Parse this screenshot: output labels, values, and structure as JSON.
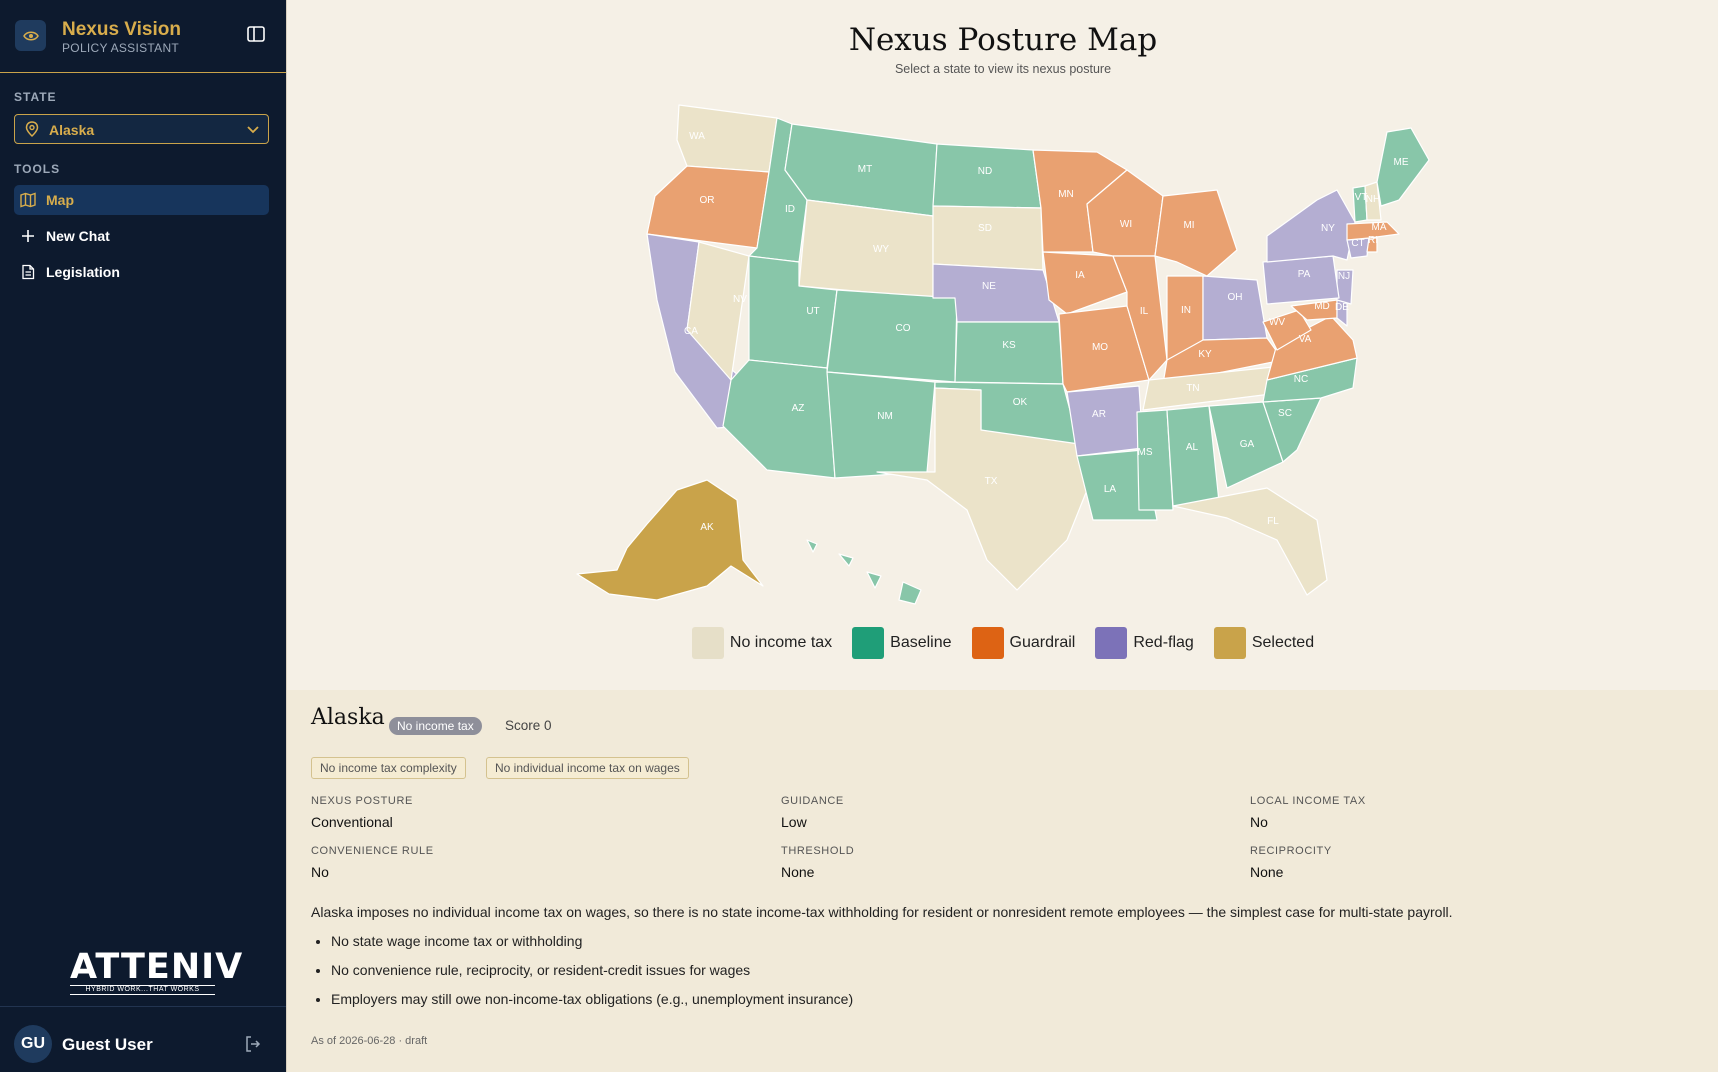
{
  "brand": {
    "name": "Nexus Vision",
    "subtitle": "POLICY ASSISTANT"
  },
  "sidebar": {
    "state_label": "STATE",
    "state_value": "Alaska",
    "tools_label": "TOOLS",
    "items": [
      {
        "label": "Map",
        "icon": "map-icon",
        "active": true
      },
      {
        "label": "New Chat",
        "icon": "plus-icon",
        "active": false
      },
      {
        "label": "Legislation",
        "icon": "document-icon",
        "active": false
      }
    ],
    "logo_text": "ATTENIV",
    "logo_tagline": "HYBRID WORK...THAT WORKS",
    "user": {
      "initials": "GU",
      "name": "Guest User"
    }
  },
  "map": {
    "title": "Nexus Posture Map",
    "subtitle": "Select a state to view its nexus posture",
    "colors": {
      "none": "#ebe3c9",
      "baseline": "#88c6a9",
      "guardrail": "#e9a171",
      "redflag": "#b4aed2",
      "selected": "#c9a34a"
    },
    "legend": [
      {
        "label": "No income tax",
        "color": "#e6dfc8"
      },
      {
        "label": "Baseline",
        "color": "#1f9e78"
      },
      {
        "label": "Guardrail",
        "color": "#dd6314"
      },
      {
        "label": "Red-flag",
        "color": "#7c72b8"
      },
      {
        "label": "Selected",
        "color": "#c9a34a"
      }
    ],
    "states": [
      {
        "code": "WA",
        "category": "none"
      },
      {
        "code": "OR",
        "category": "guardrail"
      },
      {
        "code": "CA",
        "category": "redflag"
      },
      {
        "code": "ID",
        "category": "baseline"
      },
      {
        "code": "NV",
        "category": "none"
      },
      {
        "code": "MT",
        "category": "baseline"
      },
      {
        "code": "WY",
        "category": "none"
      },
      {
        "code": "UT",
        "category": "baseline"
      },
      {
        "code": "AZ",
        "category": "baseline"
      },
      {
        "code": "CO",
        "category": "baseline"
      },
      {
        "code": "NM",
        "category": "baseline"
      },
      {
        "code": "ND",
        "category": "baseline"
      },
      {
        "code": "SD",
        "category": "none"
      },
      {
        "code": "NE",
        "category": "redflag"
      },
      {
        "code": "KS",
        "category": "baseline"
      },
      {
        "code": "OK",
        "category": "baseline"
      },
      {
        "code": "TX",
        "category": "none"
      },
      {
        "code": "MN",
        "category": "guardrail"
      },
      {
        "code": "IA",
        "category": "guardrail"
      },
      {
        "code": "MO",
        "category": "guardrail"
      },
      {
        "code": "AR",
        "category": "redflag"
      },
      {
        "code": "LA",
        "category": "baseline"
      },
      {
        "code": "WI",
        "category": "guardrail"
      },
      {
        "code": "IL",
        "category": "guardrail"
      },
      {
        "code": "MI",
        "category": "guardrail"
      },
      {
        "code": "IN",
        "category": "guardrail"
      },
      {
        "code": "OH",
        "category": "redflag"
      },
      {
        "code": "KY",
        "category": "guardrail"
      },
      {
        "code": "TN",
        "category": "none"
      },
      {
        "code": "MS",
        "category": "baseline"
      },
      {
        "code": "AL",
        "category": "baseline"
      },
      {
        "code": "GA",
        "category": "baseline"
      },
      {
        "code": "FL",
        "category": "none"
      },
      {
        "code": "SC",
        "category": "baseline"
      },
      {
        "code": "NC",
        "category": "baseline"
      },
      {
        "code": "VA",
        "category": "guardrail"
      },
      {
        "code": "WV",
        "category": "guardrail"
      },
      {
        "code": "MD",
        "category": "guardrail"
      },
      {
        "code": "DE",
        "category": "redflag"
      },
      {
        "code": "NJ",
        "category": "redflag"
      },
      {
        "code": "PA",
        "category": "redflag"
      },
      {
        "code": "NY",
        "category": "redflag"
      },
      {
        "code": "CT",
        "category": "redflag"
      },
      {
        "code": "RI",
        "category": "guardrail"
      },
      {
        "code": "MA",
        "category": "guardrail"
      },
      {
        "code": "VT",
        "category": "baseline"
      },
      {
        "code": "NH",
        "category": "none"
      },
      {
        "code": "ME",
        "category": "baseline"
      },
      {
        "code": "AK",
        "category": "selected"
      },
      {
        "code": "HI",
        "category": "baseline"
      }
    ]
  },
  "details": {
    "state": "Alaska",
    "badge": "No income tax",
    "score": "Score 0",
    "chips": [
      "No income tax complexity",
      "No individual income tax on wages"
    ],
    "fields": [
      {
        "label": "NEXUS POSTURE",
        "value": "Conventional"
      },
      {
        "label": "GUIDANCE",
        "value": "Low"
      },
      {
        "label": "LOCAL INCOME TAX",
        "value": "No"
      },
      {
        "label": "CONVENIENCE RULE",
        "value": "No"
      },
      {
        "label": "THRESHOLD",
        "value": "None"
      },
      {
        "label": "RECIPROCITY",
        "value": "None"
      }
    ],
    "description": "Alaska imposes no individual income tax on wages, so there is no state income-tax withholding for resident or nonresident remote employees — the simplest case for multi-state payroll.",
    "bullets": [
      "No state wage income tax or withholding",
      "No convenience rule, reciprocity, or resident-credit issues for wages",
      "Employers may still owe non-income-tax obligations (e.g., unemployment insurance)"
    ],
    "as_of": "As of 2026-06-28 · draft"
  }
}
